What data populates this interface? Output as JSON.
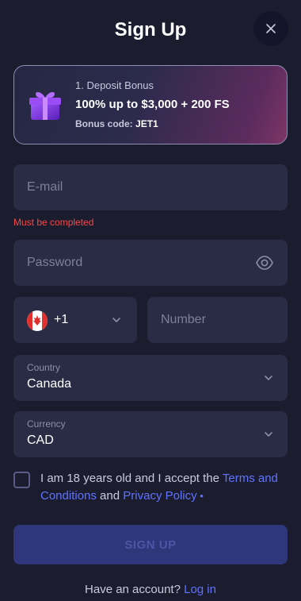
{
  "header": {
    "title": "Sign Up",
    "close_icon": "close-icon"
  },
  "bonus": {
    "label": "1. Deposit Bonus",
    "amount": "100% up to $3,000 + 200 FS",
    "code_label": "Bonus code:",
    "code_value": "JET1",
    "icon": "gift-icon"
  },
  "form": {
    "email_placeholder": "E-mail",
    "email_error": "Must be completed",
    "password_placeholder": "Password",
    "phone_code": "+1",
    "phone_flag": "canada-flag-icon",
    "number_placeholder": "Number",
    "country_label": "Country",
    "country_value": "Canada",
    "currency_label": "Currency",
    "currency_value": "CAD"
  },
  "agreement": {
    "text_before": "I am 18 years old and I accept the ",
    "terms_link": "Terms and Conditions",
    "and": " and ",
    "privacy_link": "Privacy Policy",
    "required_mark": " •"
  },
  "actions": {
    "signup_label": "SIGN UP"
  },
  "footer": {
    "question": "Have an account? ",
    "login_link": "Log in"
  },
  "colors": {
    "background": "#1b1c2e",
    "field": "#2a2b45",
    "accent_link": "#5f73ff",
    "error": "#ef4b4b",
    "button": "#30367a"
  }
}
